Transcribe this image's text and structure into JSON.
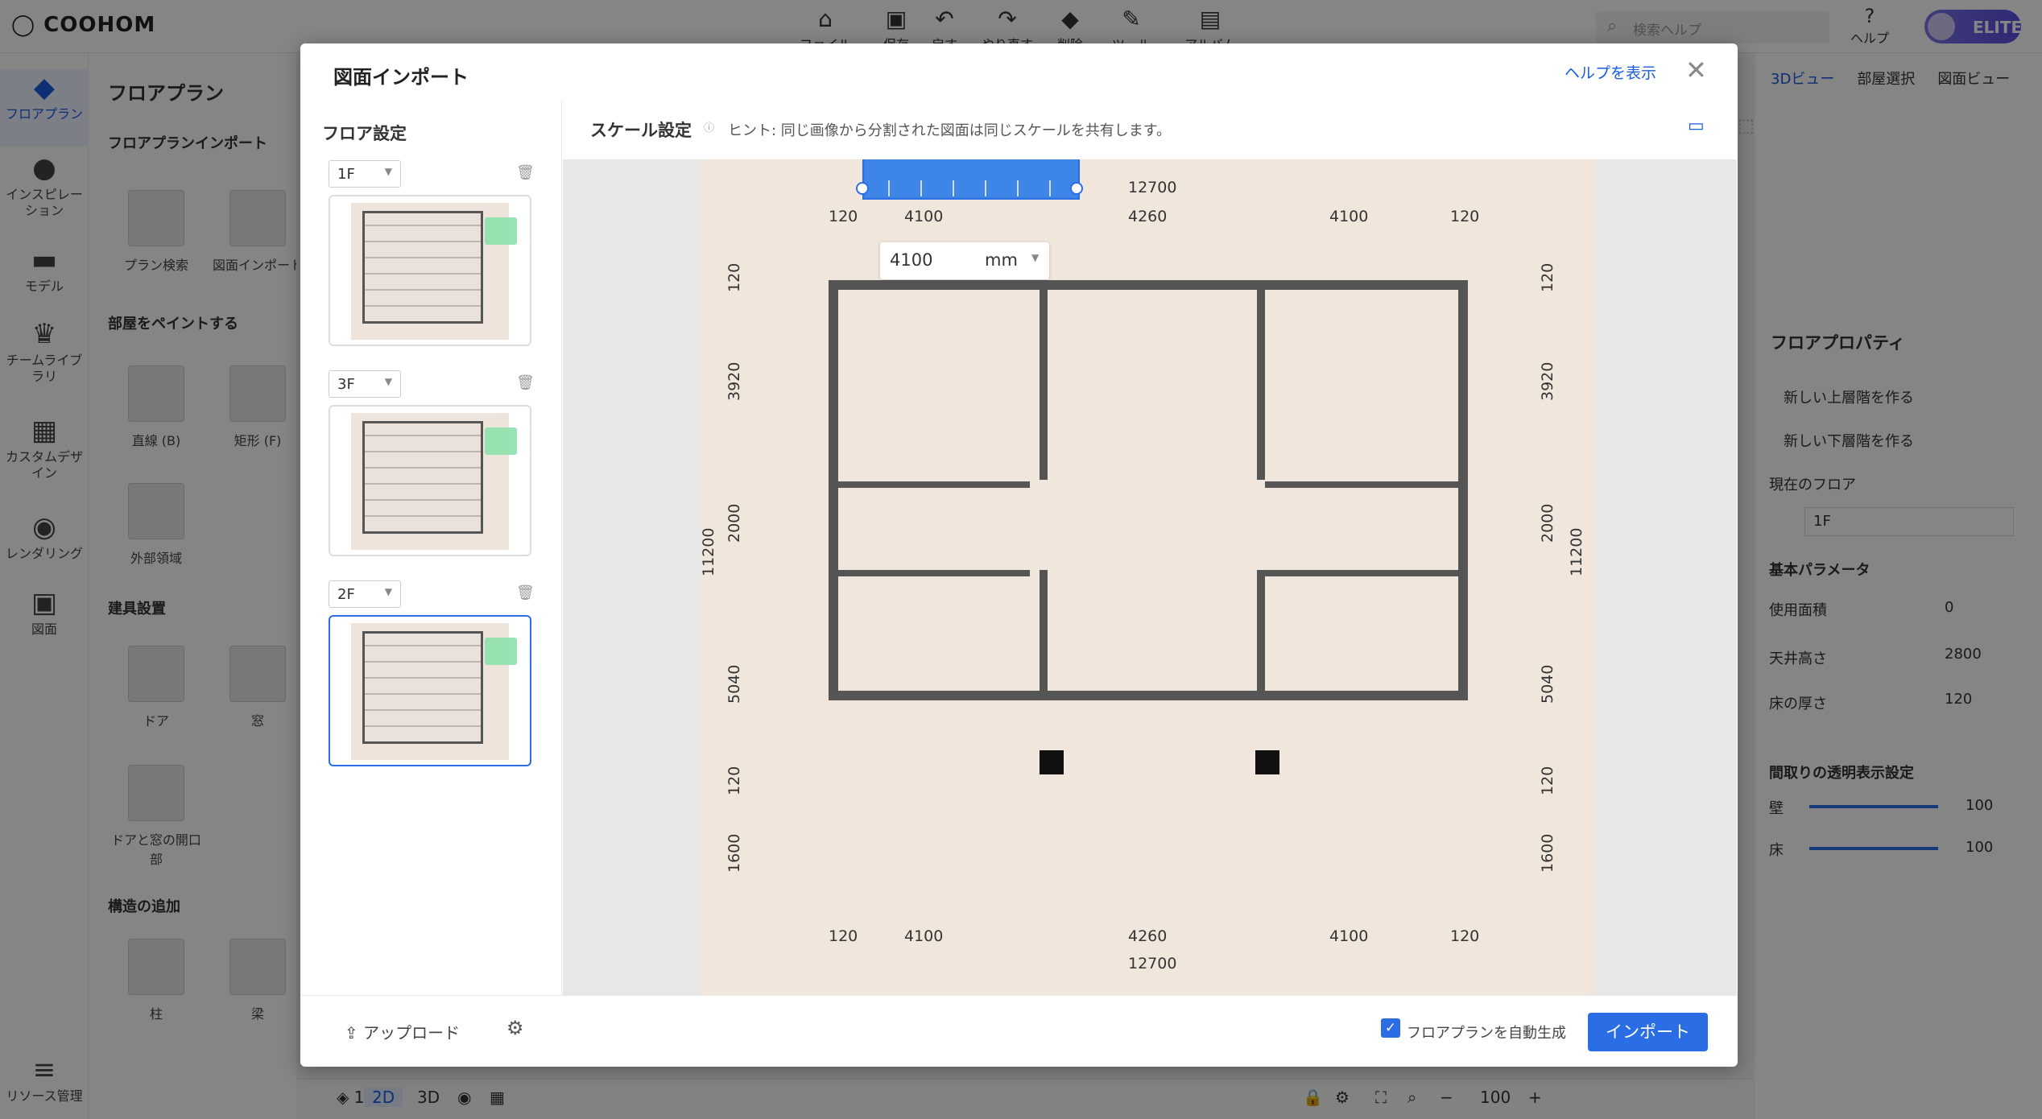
{
  "app": {
    "logo": "COOHOM",
    "elite": "ELITE",
    "search_placeholder": "検索ヘルプ",
    "help": "ヘルプ"
  },
  "toolbar": [
    {
      "label": "ファイル",
      "icon": "file-icon"
    },
    {
      "label": "保存",
      "icon": "save-icon"
    },
    {
      "label": "戻す",
      "icon": "undo-icon"
    },
    {
      "label": "やり直す",
      "icon": "redo-icon"
    },
    {
      "label": "削除",
      "icon": "erase-icon"
    },
    {
      "label": "ツール",
      "icon": "wrench-icon"
    },
    {
      "label": "アルバム",
      "icon": "album-icon"
    }
  ],
  "leftnav": [
    {
      "label": "フロアプラン"
    },
    {
      "label": "インスピレーション"
    },
    {
      "label": "モデル"
    },
    {
      "label": "チームライブラリ"
    },
    {
      "label": "カスタムデザイン"
    },
    {
      "label": "レンダリング"
    },
    {
      "label": "図面"
    },
    {
      "label": "リソース管理"
    }
  ],
  "panel": {
    "title": "フロアプラン",
    "sec_import": "フロアプランインポート",
    "plan_search": "プラン検索",
    "drawing_import": "図面インポート",
    "sec_paint": "部屋をペイントする",
    "line": "直線 (B)",
    "rect": "矩形 (F)",
    "ext": "外部領域",
    "sec_fixture": "建具設置",
    "door": "ドア",
    "window": "窓",
    "opening": "ドアと窓の開口部",
    "sec_struct": "構造の追加",
    "column": "柱",
    "beam": "梁"
  },
  "rightbar": {
    "tabs": [
      "3Dビュー",
      "部屋選択",
      "図面ビュー"
    ],
    "prop_title": "フロアプロパティ",
    "new_upper": "新しい上層階を作る",
    "new_lower": "新しい下層階を作る",
    "current_floor": "現在のフロア",
    "floor_val": "1F",
    "basic": "基本パラメータ",
    "area": "使用面積",
    "area_val": "0",
    "ceiling": "天井高さ",
    "ceiling_val": "2800",
    "thickness": "床の厚さ",
    "thickness_val": "120",
    "transparency": "間取りの透明表示設定",
    "wall": "壁",
    "wall_val": "100",
    "floor": "床",
    "floor_val2": "100",
    "mm": "mm",
    "pct": "%"
  },
  "bottombar": {
    "floor": "1F",
    "mode2d": "2D",
    "mode3d": "3D",
    "zoom": "100"
  },
  "modal": {
    "title": "図面インポート",
    "help_link": "ヘルプを表示",
    "floor_settings": "フロア設定",
    "floors": [
      "1F",
      "3F",
      "2F"
    ],
    "selected_floor_index": 2,
    "scale_title": "スケール設定",
    "hint": "ヒント: 同じ画像から分割された図面は同じスケールを共有します。",
    "length_value": "4100",
    "length_unit": "mm",
    "upload": "アップロード",
    "auto_generate": "フロアプランを自動生成",
    "auto_checked": true,
    "import_button": "インポート"
  },
  "blueprint": {
    "top_dims": [
      "120",
      "4100",
      "4260",
      "4100",
      "120"
    ],
    "top_total": "12700",
    "bottom_dims": [
      "120",
      "4100",
      "4260",
      "4100",
      "120"
    ],
    "bottom_total": "12700",
    "left_dims": [
      "120",
      "3920",
      "2000",
      "5040",
      "120",
      "1600"
    ],
    "left_total": "11200",
    "right_dims": [
      "120",
      "3920",
      "2000",
      "5040",
      "120",
      "1600"
    ],
    "right_total": "11200"
  }
}
